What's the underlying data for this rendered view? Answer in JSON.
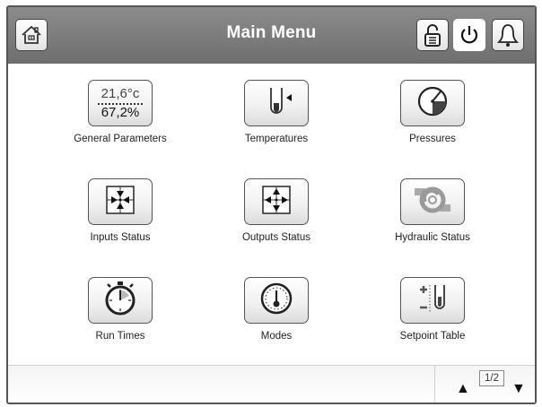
{
  "header": {
    "title": "Main Menu",
    "icons": [
      "home-icon",
      "unlock-icon",
      "power-icon",
      "bell-icon"
    ]
  },
  "menu": {
    "items": [
      {
        "label": "General Parameters",
        "icon": "parameters-readout",
        "top_value": "21,6°c",
        "bottom_value": "67,2%"
      },
      {
        "label": "Temperatures",
        "icon": "thermometer-icon"
      },
      {
        "label": "Pressures",
        "icon": "pressure-gauge-icon"
      },
      {
        "label": "Inputs Status",
        "icon": "inputs-arrows-icon"
      },
      {
        "label": "Outputs Status",
        "icon": "outputs-arrows-icon"
      },
      {
        "label": "Hydraulic Status",
        "icon": "hydraulic-icon"
      },
      {
        "label": "Run Times",
        "icon": "stopwatch-icon"
      },
      {
        "label": "Modes",
        "icon": "dial-icon"
      },
      {
        "label": "Setpoint Table",
        "icon": "setpoint-icon"
      }
    ]
  },
  "footer": {
    "page_indicator": "1/2",
    "up_arrow": "▲",
    "down_arrow": "▼"
  }
}
